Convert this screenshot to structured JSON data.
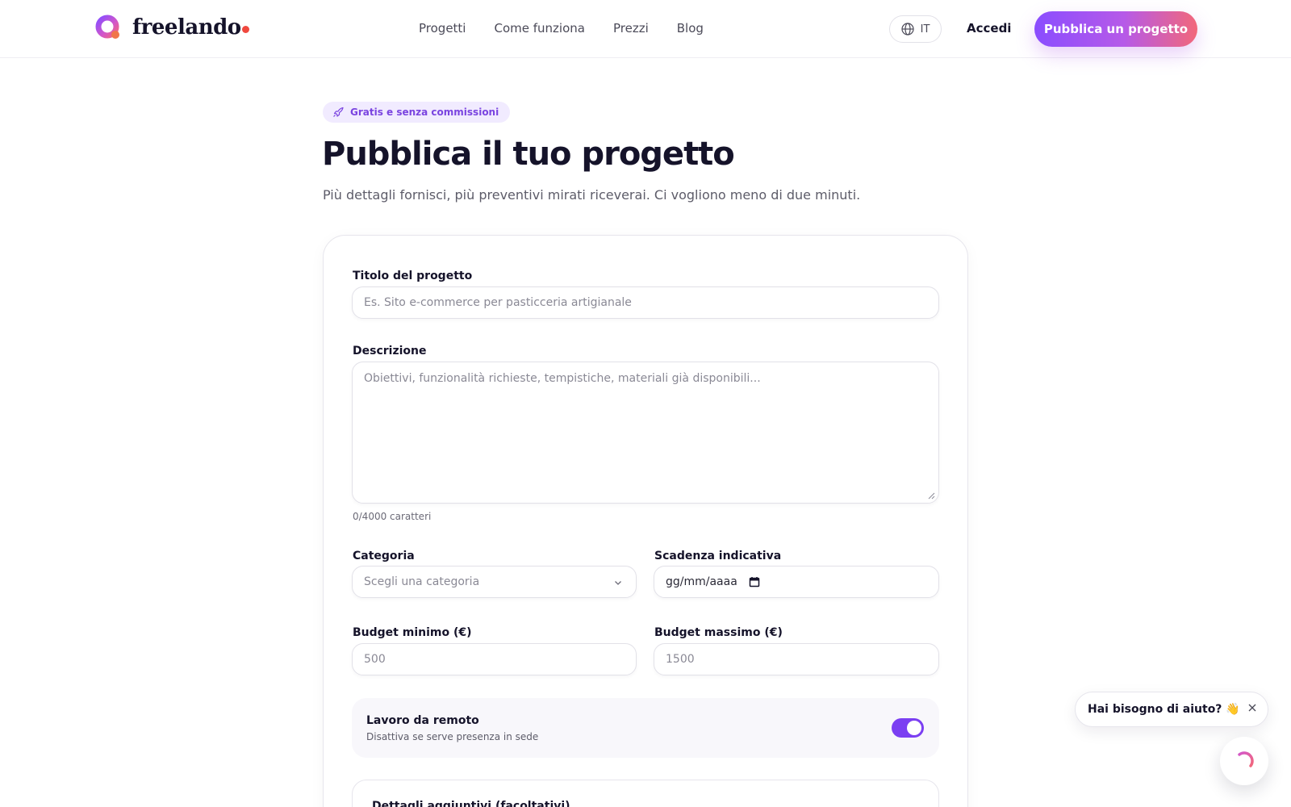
{
  "brand": {
    "name": "freelando",
    "accent_purple": "#8a4dff",
    "accent_pink": "#f2677a"
  },
  "nav": {
    "items": [
      {
        "label": "Progetti"
      },
      {
        "label": "Come funziona"
      },
      {
        "label": "Prezzi"
      },
      {
        "label": "Blog"
      }
    ]
  },
  "header": {
    "language": "IT",
    "login_label": "Accedi",
    "cta_label": "Pubblica un progetto"
  },
  "hero": {
    "badge": "Gratis e senza commissioni",
    "title": "Pubblica il tuo progetto",
    "subtitle": "Più dettagli fornisci, più preventivi mirati riceverai. Ci vogliono meno di due minuti."
  },
  "form": {
    "title_label": "Titolo del progetto",
    "title_placeholder": "Es. Sito e-commerce per pasticceria artigianale",
    "description_label": "Descrizione",
    "description_placeholder": "Obiettivi, funzionalità richieste, tempistiche, materiali già disponibili...",
    "char_count": "0/4000 caratteri",
    "category_label": "Categoria",
    "category_value": "Scegli una categoria",
    "deadline_label": "Scadenza indicativa",
    "deadline_value": "gg/mm/aaaa",
    "budget_min_label": "Budget minimo (€)",
    "budget_min_placeholder": "500",
    "budget_max_label": "Budget massimo (€)",
    "budget_max_placeholder": "1500",
    "remote_title": "Lavoro da remoto",
    "remote_subtitle": "Disattiva se serve presenza in sede",
    "remote_enabled": true,
    "details_title": "Dettagli aggiuntivi (facoltativi)"
  },
  "help": {
    "text": "Hai bisogno di aiuto? 👋"
  }
}
